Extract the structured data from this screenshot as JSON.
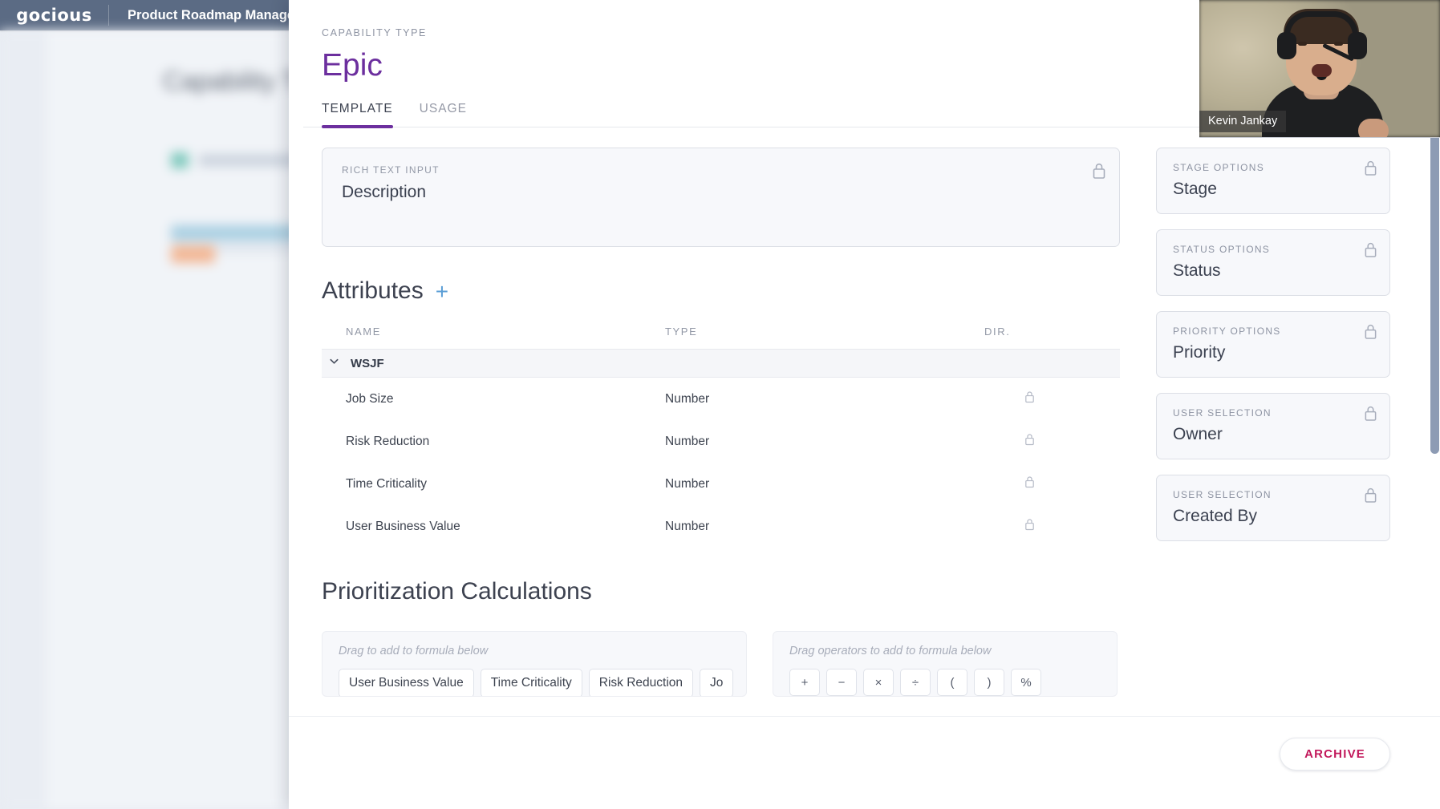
{
  "app": {
    "brand": "gocious",
    "title": "Product Roadmap Manage"
  },
  "modal": {
    "eyebrow": "CAPABILITY TYPE",
    "title": "Epic",
    "tabs": [
      {
        "label": "TEMPLATE",
        "active": true
      },
      {
        "label": "USAGE",
        "active": false
      }
    ],
    "rich_text": {
      "eyebrow": "RICH TEXT INPUT",
      "title": "Description",
      "lock_icon": "lock-icon"
    },
    "attributes": {
      "heading": "Attributes",
      "add_icon": "plus-icon",
      "columns": [
        "NAME",
        "TYPE",
        "DIR."
      ],
      "group": {
        "name": "WSJF",
        "chevron_icon": "chevron-down-icon"
      },
      "rows": [
        {
          "name": "Job Size",
          "type": "Number",
          "dir": "",
          "lock_icon": "lock-icon"
        },
        {
          "name": "Risk Reduction",
          "type": "Number",
          "dir": "",
          "lock_icon": "lock-icon"
        },
        {
          "name": "Time Criticality",
          "type": "Number",
          "dir": "",
          "lock_icon": "lock-icon"
        },
        {
          "name": "User Business Value",
          "type": "Number",
          "dir": "",
          "lock_icon": "lock-icon"
        }
      ]
    },
    "prioritization": {
      "heading": "Prioritization Calculations",
      "attributes_panel": {
        "hint": "Drag to add to formula below",
        "chips": [
          "User Business Value",
          "Time Criticality",
          "Risk Reduction",
          "Jo"
        ]
      },
      "operators_panel": {
        "hint": "Drag operators to add to formula below",
        "chips": [
          "+",
          "−",
          "×",
          "÷",
          "(",
          ")",
          "%"
        ]
      }
    },
    "side_cards": [
      {
        "eyebrow": "STAGE OPTIONS",
        "title": "Stage",
        "lock_icon": "lock-icon"
      },
      {
        "eyebrow": "STATUS OPTIONS",
        "title": "Status",
        "lock_icon": "lock-icon"
      },
      {
        "eyebrow": "PRIORITY OPTIONS",
        "title": "Priority",
        "lock_icon": "lock-icon"
      },
      {
        "eyebrow": "USER SELECTION",
        "title": "Owner",
        "lock_icon": "lock-icon"
      },
      {
        "eyebrow": "USER SELECTION",
        "title": "Created By",
        "lock_icon": "lock-icon"
      }
    ],
    "footer": {
      "archive_label": "ARCHIVE"
    }
  },
  "video": {
    "participant_name": "Kevin Jankay"
  },
  "colors": {
    "accent_purple": "#6c2f9e",
    "header_bar": "#5b6b84",
    "archive_crimson": "#c2185b",
    "add_blue": "#5a9ed6"
  }
}
